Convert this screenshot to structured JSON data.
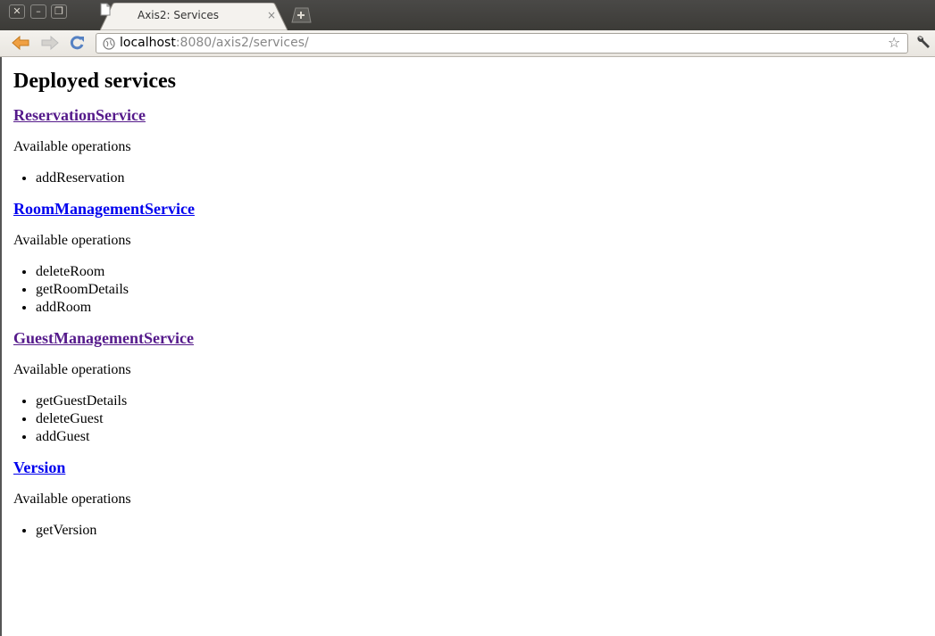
{
  "window": {
    "tab_title": "Axis2: Services",
    "tab_close": "×",
    "url_host": "localhost",
    "url_rest": ":8080/axis2/services/"
  },
  "page": {
    "heading": "Deployed services",
    "services": [
      {
        "name": "ReservationService",
        "visited": true,
        "ops_label": "Available operations",
        "operations": [
          "addReservation"
        ]
      },
      {
        "name": "RoomManagementService",
        "visited": false,
        "ops_label": "Available operations",
        "operations": [
          "deleteRoom",
          "getRoomDetails",
          "addRoom"
        ]
      },
      {
        "name": "GuestManagementService",
        "visited": true,
        "ops_label": "Available operations",
        "operations": [
          "getGuestDetails",
          "deleteGuest",
          "addGuest"
        ]
      },
      {
        "name": "Version",
        "visited": false,
        "ops_label": "Available operations",
        "operations": [
          "getVersion"
        ]
      }
    ]
  },
  "colors": {
    "link": "#0000ee",
    "visited_link": "#551a8b"
  }
}
